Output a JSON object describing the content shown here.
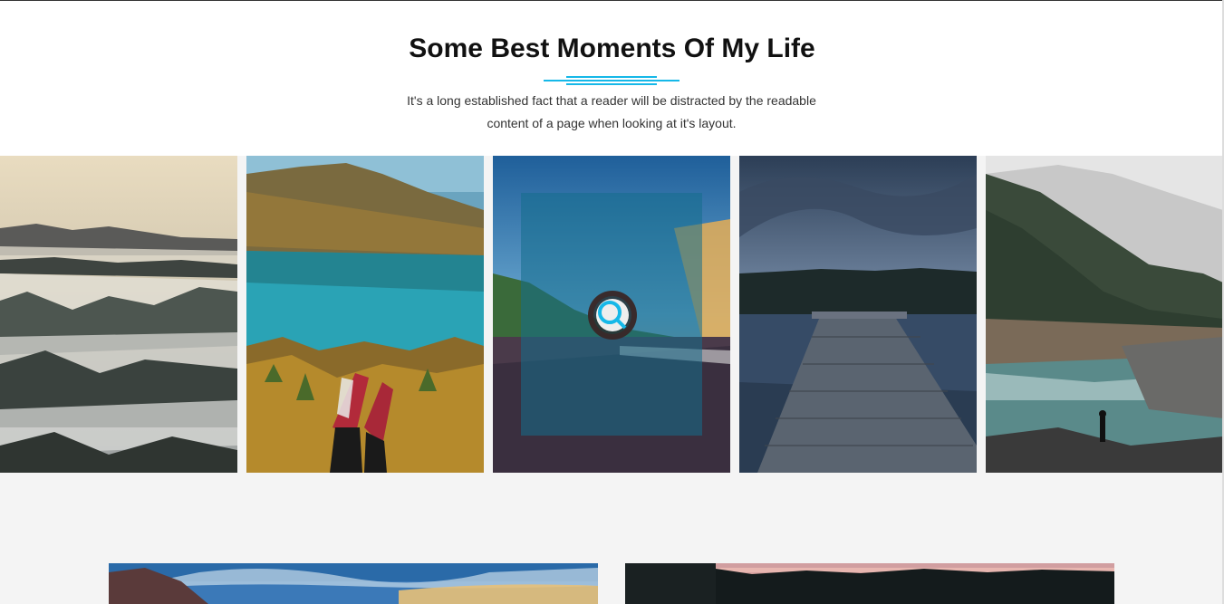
{
  "section": {
    "title": "Some Best Moments Of My Life",
    "description": "It's a long established fact that a reader will be distracted by the readable content of a page when looking at it's layout."
  },
  "gallery": {
    "items": [
      {
        "scene": "foggy-valley"
      },
      {
        "scene": "mountain-lake-with-sneakers"
      },
      {
        "scene": "coastal-road-sunset",
        "hover": true
      },
      {
        "scene": "wooden-pier-lake"
      },
      {
        "scene": "misty-forest-river"
      }
    ],
    "zoom_icon": "search-icon"
  },
  "featured": [
    {
      "scene": "coastal-road-sky"
    },
    {
      "scene": "forest-lake-dusk"
    }
  ],
  "colors": {
    "accent": "#16b8e8",
    "section_bg": "#ffffff",
    "page_bg": "#f4f4f4"
  }
}
